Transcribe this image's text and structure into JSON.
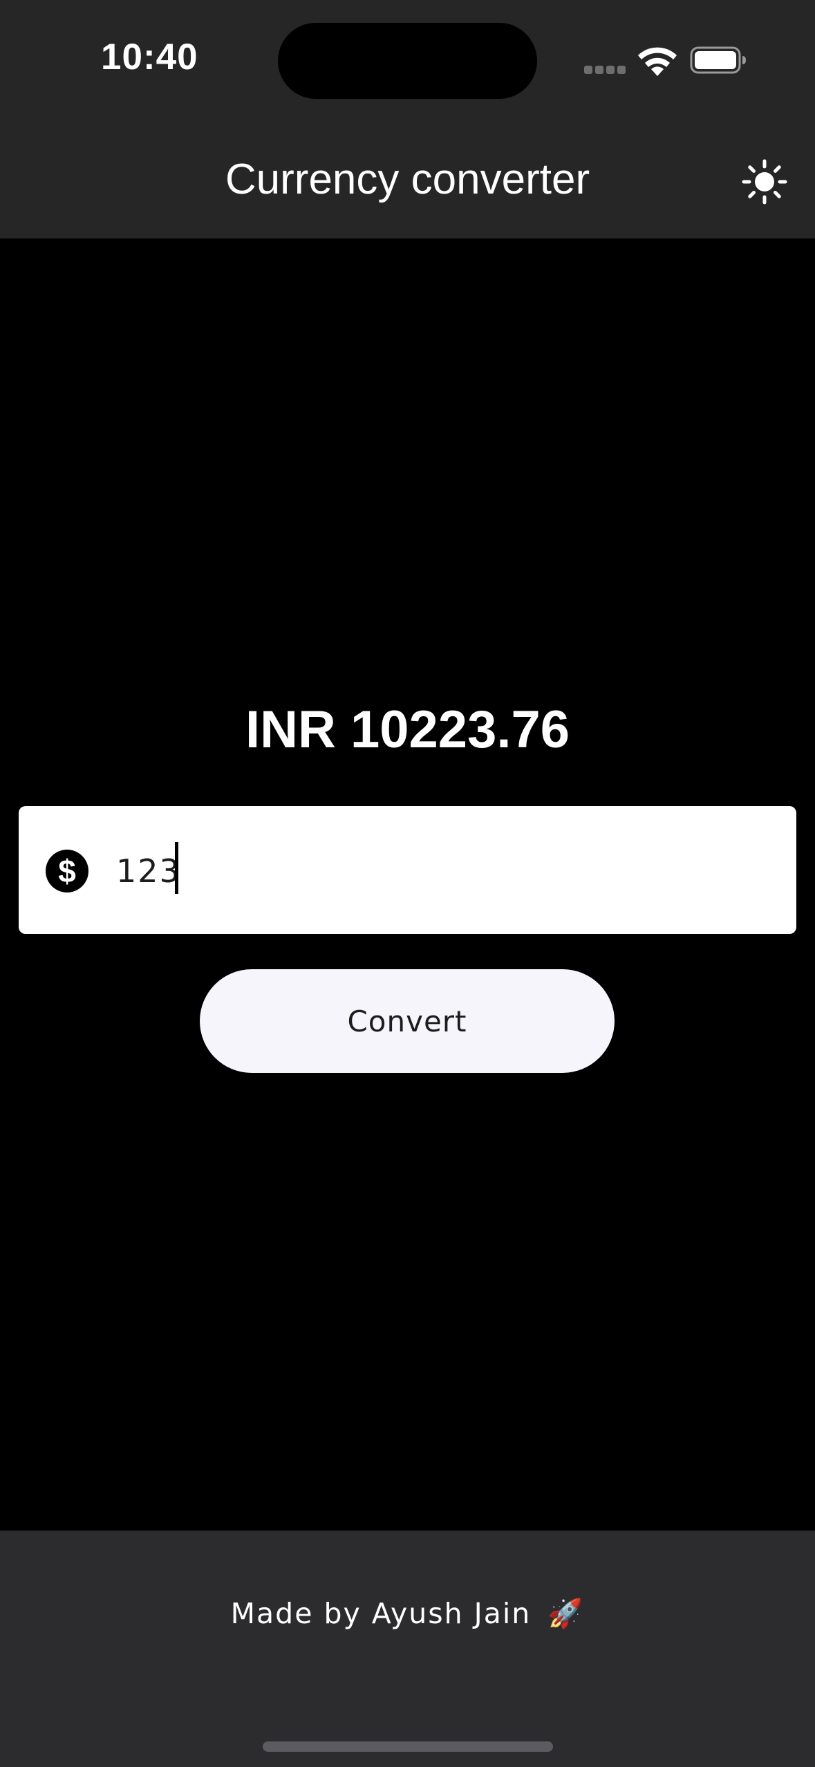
{
  "status_bar": {
    "time": "10:40"
  },
  "app_bar": {
    "title": "Currency converter",
    "theme_toggle_icon": "sun-icon"
  },
  "converter": {
    "result": "INR 10223.76",
    "amount_value": "123",
    "amount_prefix_icon": "dollar-circle-icon",
    "convert_label": "Convert"
  },
  "footer": {
    "credit": "Made by Ayush Jain",
    "credit_icon": "rocket-icon",
    "credit_emoji": "🚀"
  },
  "colors": {
    "app_bar_bg": "#262626",
    "body_bg": "#000000",
    "footer_bg": "#2c2c2f",
    "button_bg": "#f7f5fc",
    "text_primary": "#ffffff"
  }
}
